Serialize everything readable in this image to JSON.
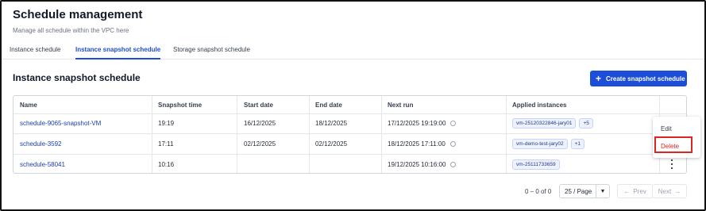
{
  "header": {
    "title": "Schedule management",
    "subtitle": "Manage all schedule within the VPC here"
  },
  "tabs": [
    {
      "label": "Instance schedule",
      "active": false
    },
    {
      "label": "Instance snapshot schedule",
      "active": true
    },
    {
      "label": "Storage snapshot schedule",
      "active": false
    }
  ],
  "section": {
    "title": "Instance snapshot schedule",
    "create_button": "Create snapshot schedule",
    "create_icon": "+"
  },
  "table": {
    "columns": [
      "Name",
      "Snapshot time",
      "Start date",
      "End date",
      "Next run",
      "Applied instances"
    ],
    "rows": [
      {
        "name": "schedule-9065-snapshot-VM",
        "snapshot_time": "19:19",
        "start_date": "16/12/2025",
        "end_date": "18/12/2025",
        "next_run": "17/12/2025 19:19:00",
        "instance": "vm-25120322846-jary01",
        "more": "+5"
      },
      {
        "name": "schedule-3592",
        "snapshot_time": "17:11",
        "start_date": "02/12/2025",
        "end_date": "02/12/2025",
        "next_run": "18/12/2025 17:11:00",
        "instance": "vm-demo-test-jary02",
        "more": "+1"
      },
      {
        "name": "schedule-58041",
        "snapshot_time": "10:16",
        "start_date": "",
        "end_date": "",
        "next_run": "19/12/2025 10:16:00",
        "instance": "vm-25111733659",
        "more": ""
      }
    ]
  },
  "context_menu": {
    "edit": "Edit",
    "delete": "Delete"
  },
  "pagination": {
    "info": "0 – 0 of 0",
    "page_size": "25 / Page",
    "prev": "Prev",
    "next": "Next"
  },
  "colors": {
    "accent": "#1d4ed8",
    "danger": "#dc2626",
    "link": "#1e40af"
  }
}
